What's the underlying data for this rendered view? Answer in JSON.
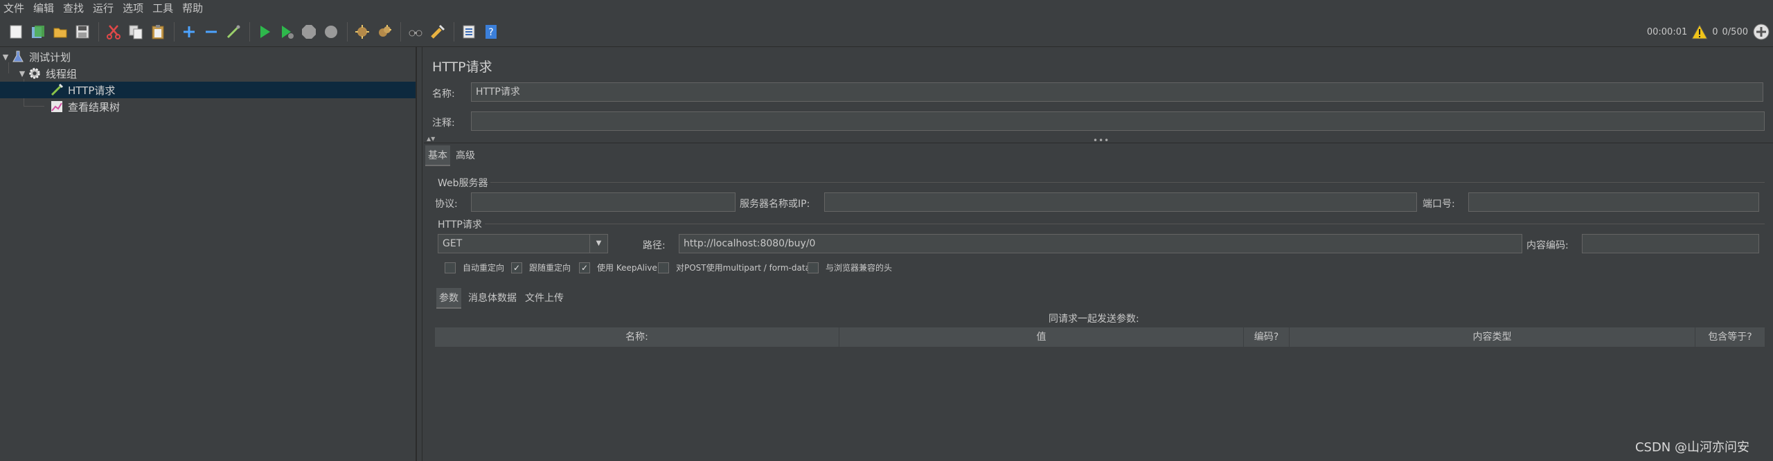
{
  "menubar": {
    "items": [
      "文件",
      "编辑",
      "查找",
      "运行",
      "选项",
      "工具",
      "帮助"
    ]
  },
  "toolbar": {
    "icons": [
      "new-icon",
      "templates-icon",
      "open-icon",
      "save-icon",
      "cut-icon",
      "copy-icon",
      "paste-icon",
      "expand-icon",
      "collapse-icon",
      "toggle-icon",
      "start-icon",
      "start-no-pause-icon",
      "stop-icon",
      "shutdown-icon",
      "clear-icon",
      "clear-all-icon",
      "search-icon",
      "reset-search-icon",
      "function-helper-icon",
      "help-icon"
    ],
    "elapsed": "00:00:01",
    "warnings": "0",
    "threads": "0/500"
  },
  "tree": {
    "items": [
      {
        "label": "测试计划",
        "icon": "flask-icon"
      },
      {
        "label": "线程组",
        "icon": "gear-icon"
      },
      {
        "label": "HTTP请求",
        "icon": "pipette-icon"
      },
      {
        "label": "查看结果树",
        "icon": "chart-icon"
      }
    ]
  },
  "panel": {
    "title": "HTTP请求",
    "name_label": "名称:",
    "name_value": "HTTP请求",
    "comment_label": "注释:",
    "comment_value": "",
    "tabs": [
      "基本",
      "高级"
    ],
    "web_server": {
      "title": "Web服务器",
      "protocol_label": "协议:",
      "protocol_value": "",
      "server_label": "服务器名称或IP:",
      "server_value": "",
      "port_label": "端口号:",
      "port_value": ""
    },
    "http_request": {
      "title": "HTTP请求",
      "method": "GET",
      "path_label": "路径:",
      "path_value": "http://localhost:8080/buy/0",
      "encoding_label": "内容编码:",
      "encoding_value": ""
    },
    "checkboxes": [
      {
        "label": "自动重定向",
        "checked": false
      },
      {
        "label": "跟随重定向",
        "checked": true
      },
      {
        "label": "使用 KeepAlive",
        "checked": true
      },
      {
        "label": "对POST使用multipart / form-data",
        "checked": false
      },
      {
        "label": "与浏览器兼容的头",
        "checked": false
      }
    ],
    "subtabs": [
      "参数",
      "消息体数据",
      "文件上传"
    ],
    "params_caption": "同请求一起发送参数:",
    "columns": [
      "名称:",
      "值",
      "编码?",
      "内容类型",
      "包含等于?"
    ]
  },
  "watermark": "CSDN @山河亦问安"
}
